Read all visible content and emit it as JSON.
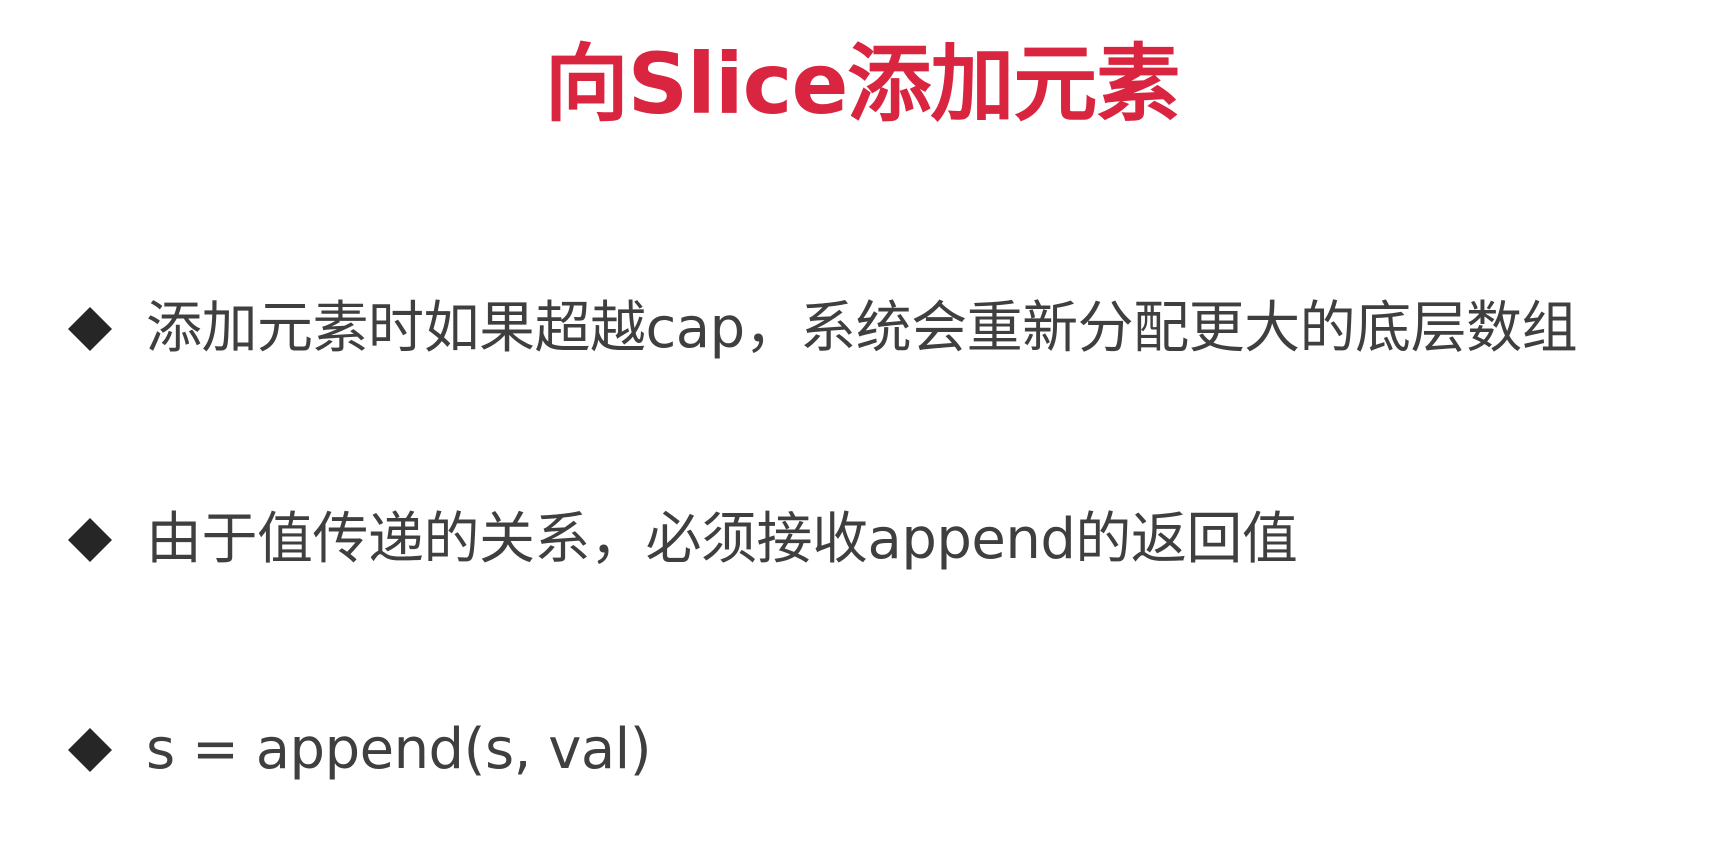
{
  "slide": {
    "title": "向Slice添加元素",
    "title_color": "#d9253f",
    "bullets": [
      {
        "icon": "diamond-bullet-icon",
        "text": "添加元素时如果超越cap，系统会重新分配更大的底层数组"
      },
      {
        "icon": "diamond-bullet-icon",
        "text": "由于值传递的关系，必须接收append的返回值"
      },
      {
        "icon": "diamond-bullet-icon",
        "text": "s = append(s, val)"
      }
    ]
  }
}
